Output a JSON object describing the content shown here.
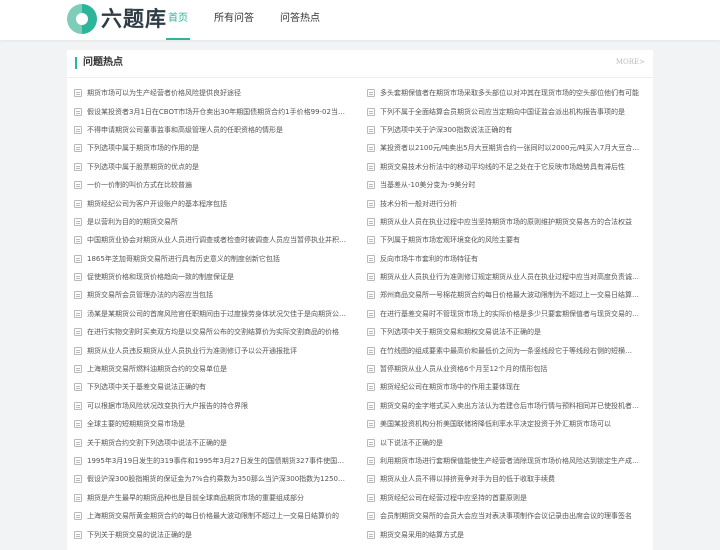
{
  "site": {
    "logo_text": "六题库"
  },
  "nav": [
    {
      "label": "首页",
      "active": true
    },
    {
      "label": "所有问答",
      "active": false
    },
    {
      "label": "问答热点",
      "active": false
    }
  ],
  "section": {
    "title": "问题热点",
    "more": "MORE>"
  },
  "questions_left": [
    "期货市场可以为生产经营者价格风险提供良好途径",
    "假设某投资者3月1日在CBOT市场开仓卖出30年期国债期货合约1手价格99-02当日30…",
    "不得申请期货公司董事监事和高级管理人员的任职资格的情形是",
    "下列选项中属于期货市场的作用的是",
    "下列选项中属于股票期货的优点的是",
    "一价一价制的叫价方式在比较普遍",
    "期货经纪公司为客户开设账户的基本程序包括",
    "是以营利为目的的期货交易所",
    "中国期货业协会对期货从业人员进行调查或者检查时被调查人员应当暂停执业并积…",
    "1865年芝加哥期货交易所进行具有历史意义的制度创新它包括",
    "促使期货价格和现货价格趋向一致的制度保证是",
    "期货交易所会员管理办法的内容应当包括",
    "汤某是某期货公司的首席风险官任职期间由于过度操劳身体状况欠佳于是向期货公…",
    "在进行实物交割时买卖双方均是以交易所公布的交割结算价为实际交割商品的价格",
    "期货从业人员违反期货从业人员执业行为准则修订予以公开通报批评",
    "上海期货交易所燃料油期货合约的交易单位是",
    "下列选项中关于基差交易说法正确的有",
    "可以根据市场风险状况改变执行大户报告的持仓界限",
    "全球主要的短期期货交易市场是",
    "关于期货合约交割下列选项中说法不正确的是",
    "1995年3月19日发生的319事件和1995年3月27日发生的国债期货327事件使国务院证…",
    "假设沪深300股指期货的保证金为7%合约乘数为350那么当沪深300指数为1250点时…",
    "期货是产生最早的期货品种也是目前全球商品期货市场的重要组成部分",
    "上海期货交易所黄金期货合约的每日价格最大波动限制不超过上一交易日结算价的",
    "下列关于期货交易的说法正确的是"
  ],
  "questions_right": [
    "多头套期保值者在期货市场采取多头部位以对冲其在现货市场的空头部位他们有可能",
    "下列不属于全面结算会员期货公司应当定期向中国证监会派出机构报告事项的是",
    "下列选项中关于沪深300指数说法正确的有",
    "某投资者以2100元/吨卖出5月大豆期货合约一张同时以2000元/吨买入7月大豆合…",
    "期货交易技术分析法中的移动平均线的不足之处在于它反映市场趋势具有滞后性",
    "当基差从-10美分变为-9美分时",
    "技术分析一般对进行分析",
    "期货从业人员在执业过程中应当坚持期货市场的原则维护期货交易各方的合法权益",
    "下列属于期货市场宏观环境变化的风险主要有",
    "反向市场牛市套利的市场特征有",
    "期货从业人员执业行为准则修订规定期货从业人员在执业过程中应当对高度负责诚…",
    "郑州商品交易所一号棉花期货合约每日价格最大波动限制为不超过上一交易日结算…",
    "在进行基差交易时不管现货市场上的实际价格是多少只要套期保值者与现货交易的…",
    "下列选项中关于期货交易和期权交易说法不正确的是",
    "在竹线图的组成要素中最高价和最低价之间为一条竖线段它于等线段右侧的短横…",
    "暂停期货从业人员从业资格6个月至12个月的情形包括",
    "期货经纪公司在期货市场中的作用主要体现在",
    "期货交易的金字塔式买入卖出方法认为若建仓后市场行情与预料相同并已使投机者…",
    "美国某投资机构分析美国联储将降低利率水平决定投资于外汇期货市场可以",
    "以下说法不正确的是",
    "利用期货市场进行套期保值能使生产经营者消除现货市场价格风险达到锁定生产成…",
    "期货从业人员不得以排挤竞争对手为目的低于收取手续费",
    "期货经纪公司在经营过程中应坚持的首要原则是",
    "会员制期货交易所的会员大会应当对表决事项制作会议记录由出席会议的理事签名",
    "期货交易采用的结算方式是"
  ]
}
